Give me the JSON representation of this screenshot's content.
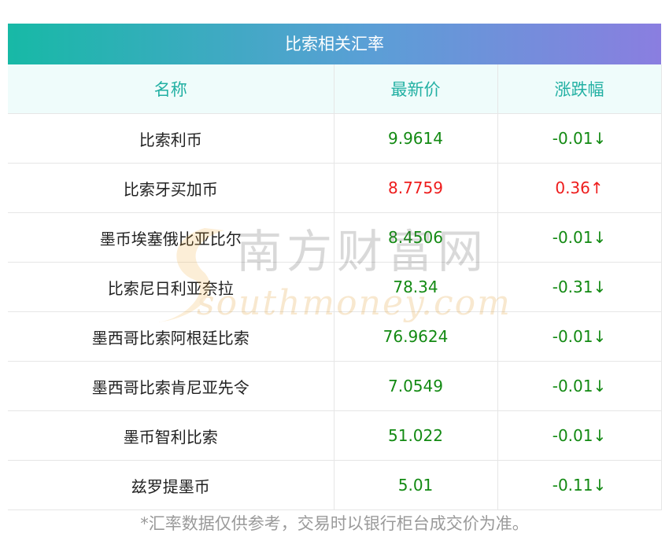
{
  "title": "比索相关汇率",
  "headers": [
    "名称",
    "最新价",
    "涨跌幅"
  ],
  "rows": [
    {
      "name": "比索利币",
      "price": "9.9614",
      "change": "-0.01",
      "arrow": "↓",
      "dir": "down"
    },
    {
      "name": "比索牙买加币",
      "price": "8.7759",
      "change": "0.36",
      "arrow": "↑",
      "dir": "up"
    },
    {
      "name": "墨币埃塞俄比亚比尔",
      "price": "8.4506",
      "change": "-0.01",
      "arrow": "↓",
      "dir": "down"
    },
    {
      "name": "比索尼日利亚奈拉",
      "price": "78.34",
      "change": "-0.31",
      "arrow": "↓",
      "dir": "down"
    },
    {
      "name": "墨西哥比索阿根廷比索",
      "price": "76.9624",
      "change": "-0.01",
      "arrow": "↓",
      "dir": "down"
    },
    {
      "name": "墨西哥比索肯尼亚先令",
      "price": "7.0549",
      "change": "-0.01",
      "arrow": "↓",
      "dir": "down"
    },
    {
      "name": "墨币智利比索",
      "price": "51.022",
      "change": "-0.01",
      "arrow": "↓",
      "dir": "down"
    },
    {
      "name": "兹罗提墨币",
      "price": "5.01",
      "change": "-0.11",
      "arrow": "↓",
      "dir": "down"
    }
  ],
  "watermark": {
    "cn": "南方财富网",
    "en": "southmoney.com"
  },
  "footnote": "*汇率数据仅供参考，交易时以银行柜台成交价为准。",
  "colors": {
    "down": "#138a13",
    "up": "#ee1c1c",
    "header_text": "#22b0a3"
  }
}
